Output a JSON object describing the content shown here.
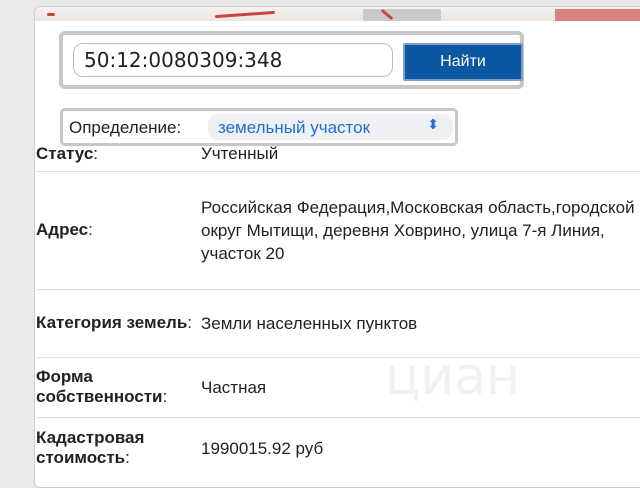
{
  "search": {
    "value": "50:12:0080309:348",
    "button_label": "Найти"
  },
  "definition": {
    "label": "Определение:",
    "selected": "земельный участок"
  },
  "rows": [
    {
      "label": "Статус",
      "value": "Учтенный"
    },
    {
      "label": "Адрес",
      "value": "Российская Федерация,Московская область,городской округ Мытищи, деревня Ховрино, улица 7-я Линия, участок 20"
    },
    {
      "label": "Категория земель",
      "value": "Земли населенных пунктов"
    },
    {
      "label": "Форма собственности",
      "value": "Частная"
    },
    {
      "label": "Кадастровая стоимость",
      "value": "1990015.92 руб"
    }
  ],
  "watermark": "циан",
  "colors": {
    "button_bg": "#0b57a3",
    "select_text": "#1e6fd1"
  }
}
